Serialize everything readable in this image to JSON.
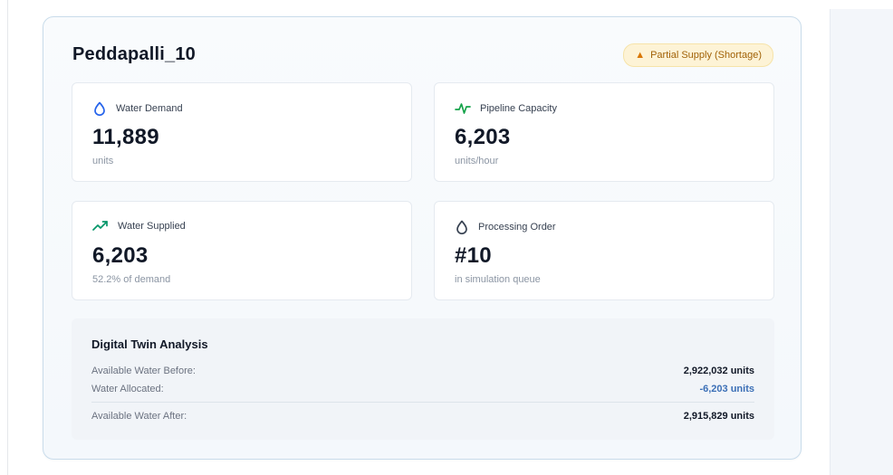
{
  "region": {
    "title": "Peddapalli_10",
    "status_badge": {
      "icon": "warning-icon",
      "label": "Partial Supply (Shortage)",
      "color": "#a16207",
      "background": "#fdf3d6"
    }
  },
  "metrics": [
    {
      "icon": "droplet-icon",
      "label": "Water Demand",
      "value": "11,889",
      "sub": "units",
      "icon_color": "#2563eb"
    },
    {
      "icon": "activity-icon",
      "label": "Pipeline Capacity",
      "value": "6,203",
      "sub": "units/hour",
      "icon_color": "#16a34a"
    },
    {
      "icon": "trending-up-icon",
      "label": "Water Supplied",
      "value": "6,203",
      "sub": "52.2% of demand",
      "icon_color": "#059669"
    },
    {
      "icon": "droplet-icon",
      "label": "Processing Order",
      "value": "#10",
      "sub": "in simulation queue",
      "icon_color": "#374151"
    }
  ],
  "analysis": {
    "title": "Digital Twin Analysis",
    "rows": [
      {
        "label": "Available Water Before:",
        "value": "2,922,032 units"
      },
      {
        "label": "Water Allocated:",
        "value": "-6,203 units",
        "value_color": "#3b6fb6"
      },
      {
        "label": "Available Water After:",
        "value": "2,915,829 units"
      }
    ]
  }
}
